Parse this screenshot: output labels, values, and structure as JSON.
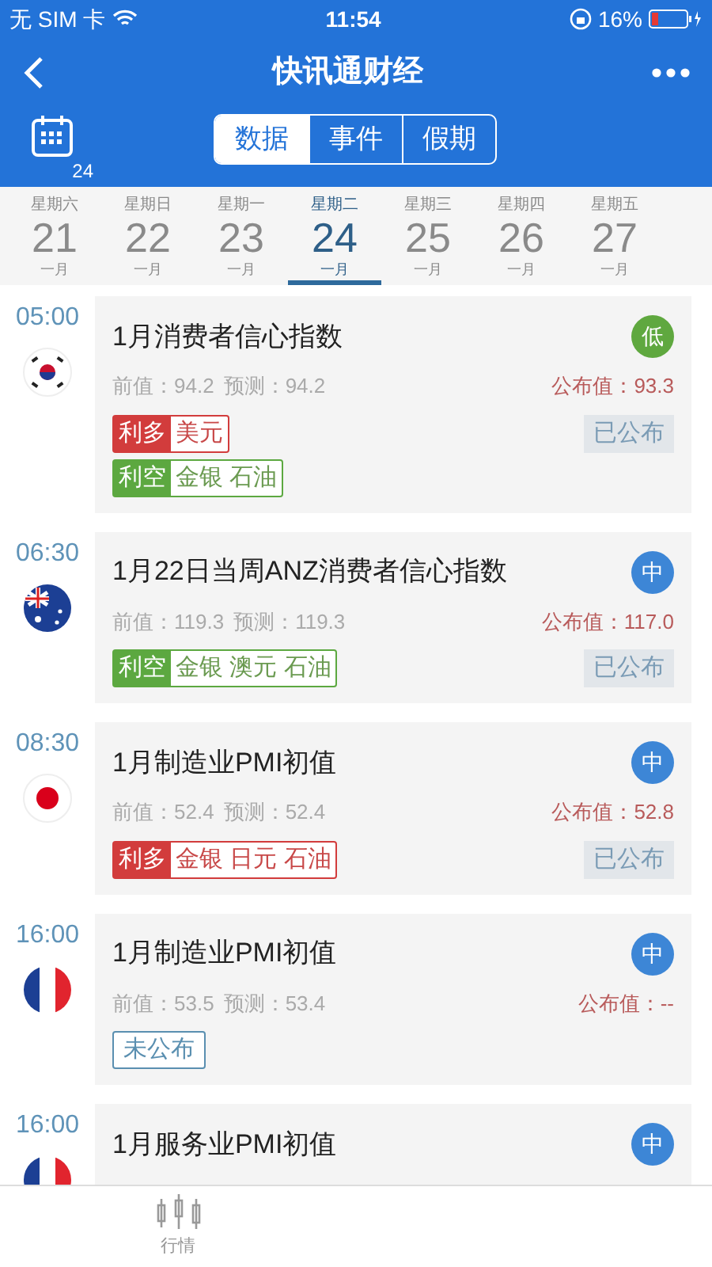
{
  "status_bar": {
    "carrier": "无 SIM 卡",
    "time": "11:54",
    "battery": "16%"
  },
  "nav": {
    "title": "快讯通财经",
    "calendar_day": "24"
  },
  "tabs": [
    {
      "label": "数据",
      "selected": true
    },
    {
      "label": "事件",
      "selected": false
    },
    {
      "label": "假期",
      "selected": false
    }
  ],
  "dates": [
    {
      "weekday": "星期六",
      "day": "21",
      "month": "一月",
      "selected": false
    },
    {
      "weekday": "星期日",
      "day": "22",
      "month": "一月",
      "selected": false
    },
    {
      "weekday": "星期一",
      "day": "23",
      "month": "一月",
      "selected": false
    },
    {
      "weekday": "星期二",
      "day": "24",
      "month": "一月",
      "selected": true
    },
    {
      "weekday": "星期三",
      "day": "25",
      "month": "一月",
      "selected": false
    },
    {
      "weekday": "星期四",
      "day": "26",
      "month": "一月",
      "selected": false
    },
    {
      "weekday": "星期五",
      "day": "27",
      "month": "一月",
      "selected": false
    }
  ],
  "events": [
    {
      "time": "05:00",
      "flag": {
        "kind": "kr"
      },
      "title": "1月消费者信心指数",
      "importance": {
        "label": "低",
        "color": "#5fa83f"
      },
      "previous": "前值：94.2",
      "forecast": "预测：94.2",
      "actual": "公布值：93.3",
      "status": "已公布",
      "published": true,
      "impacts": [
        {
          "kind": "bull",
          "label": "利多",
          "assets": "美元"
        },
        {
          "kind": "bear",
          "label": "利空",
          "assets": "金银 石油"
        }
      ]
    },
    {
      "time": "06:30",
      "flag": {
        "kind": "au"
      },
      "title": "1月22日当周ANZ消费者信心指数",
      "importance": {
        "label": "中",
        "color": "#3d86d6"
      },
      "previous": "前值：119.3",
      "forecast": "预测：119.3",
      "actual": "公布值：117.0",
      "status": "已公布",
      "published": true,
      "impacts": [
        {
          "kind": "bear",
          "label": "利空",
          "assets": "金银 澳元 石油"
        }
      ]
    },
    {
      "time": "08:30",
      "flag": {
        "kind": "jp"
      },
      "title": "1月制造业PMI初值",
      "importance": {
        "label": "中",
        "color": "#3d86d6"
      },
      "previous": "前值：52.4",
      "forecast": "预测：52.4",
      "actual": "公布值：52.8",
      "status": "已公布",
      "published": true,
      "impacts": [
        {
          "kind": "bull",
          "label": "利多",
          "assets": "金银 日元 石油"
        }
      ]
    },
    {
      "time": "16:00",
      "flag": {
        "kind": "fr"
      },
      "title": "1月制造业PMI初值",
      "importance": {
        "label": "中",
        "color": "#3d86d6"
      },
      "previous": "前值：53.5",
      "forecast": "预测：53.4",
      "actual": "公布值：--",
      "status": "未公布",
      "published": false
    },
    {
      "time": "16:00",
      "flag": {
        "kind": "fr"
      },
      "title": "1月服务业PMI初值",
      "importance": {
        "label": "中",
        "color": "#3d86d6"
      }
    }
  ],
  "bottom_tabs": [
    {
      "label": "行情"
    }
  ]
}
